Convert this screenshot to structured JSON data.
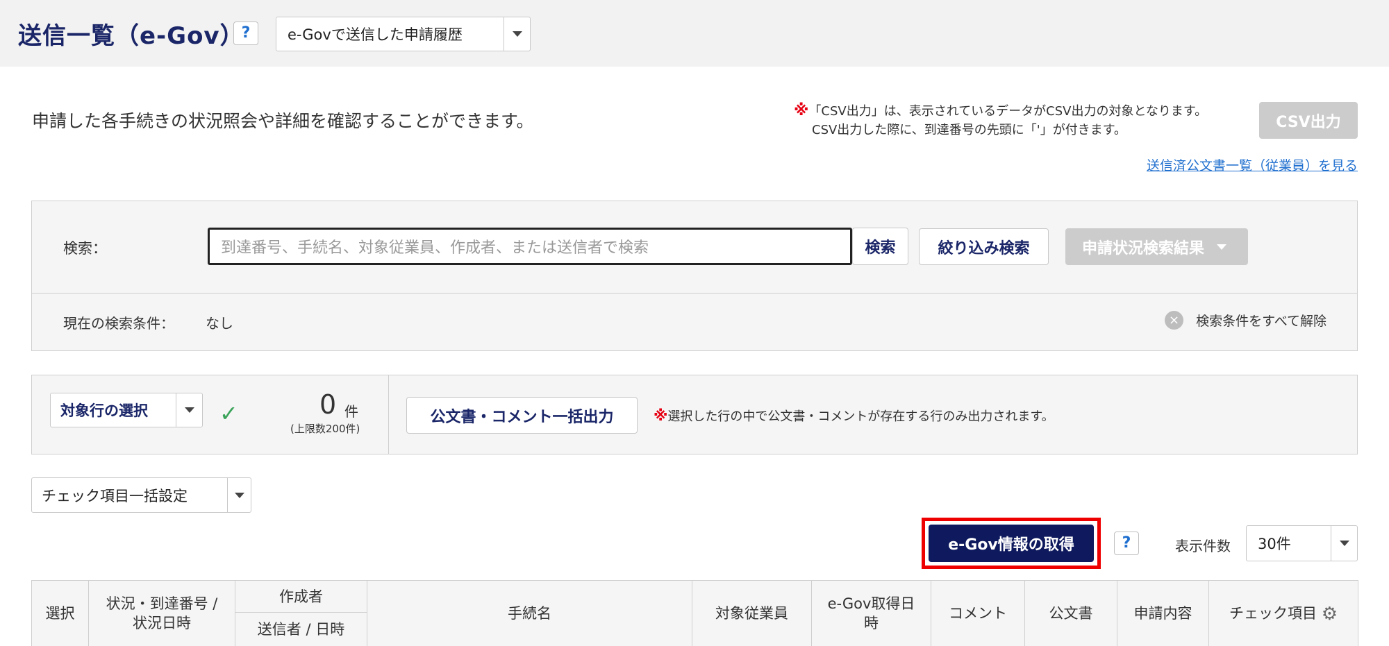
{
  "header": {
    "title": "送信一覧（e-Gov）",
    "help": "?",
    "view_select": {
      "value": "e-Govで送信した申請履歴"
    }
  },
  "intro": {
    "description": "申請した各手続きの状況照会や詳細を確認することができます。",
    "note_mark": "※",
    "note_line1": "「CSV出力」は、表示されているデータがCSV出力の対象となります。",
    "note_line2": "CSV出力した際に、到達番号の先頭に「'」が付きます。",
    "csv_button": "CSV出力",
    "issued_docs_link": "送信済公文書一覧（従業員）を見る"
  },
  "search": {
    "label": "検索：",
    "placeholder": "到達番号、手続名、対象従業員、作成者、または送信者で検索",
    "search_button": "検索",
    "filter_button": "絞り込み検索",
    "status_results_button": "申請状況検索結果",
    "condition_label": "現在の検索条件：",
    "condition_value": "なし",
    "clear_icon": "×",
    "clear_all": "検索条件をすべて解除"
  },
  "bulk": {
    "row_select": "対象行の選択",
    "check": "✓",
    "count": "0",
    "count_unit": "件",
    "count_limit": "(上限数200件)",
    "export_button": "公文書・コメント一括出力",
    "note_mark": "※",
    "note": "選択した行の中で公文書・コメントが存在する行のみ出力されます。"
  },
  "check_settings": {
    "value": "チェック項目一括設定"
  },
  "toolbar": {
    "fetch_button": "e-Gov情報の取得",
    "help": "?",
    "per_page_label": "表示件数",
    "per_page_value": "30件"
  },
  "table": {
    "headers": {
      "select": "選択",
      "status_line1": "状況・到達番号 /",
      "status_line2": "状況日時",
      "creator": "作成者",
      "sender": "送信者 / 日時",
      "procedure": "手続名",
      "employee": "対象従業員",
      "egov_date_line1": "e-Gov取得日",
      "egov_date_line2": "時",
      "comment": "コメント",
      "official_doc": "公文書",
      "application": "申請内容",
      "check_items": "チェック項目",
      "settings_icon": "⚙"
    }
  },
  "colors": {
    "brand_navy": "#0f1a5e",
    "link_blue": "#1f6fcf",
    "warning_red": "#e60012",
    "highlight_red": "#ee0000",
    "disabled_gray": "#cccccc",
    "check_green": "#3aa35a"
  }
}
